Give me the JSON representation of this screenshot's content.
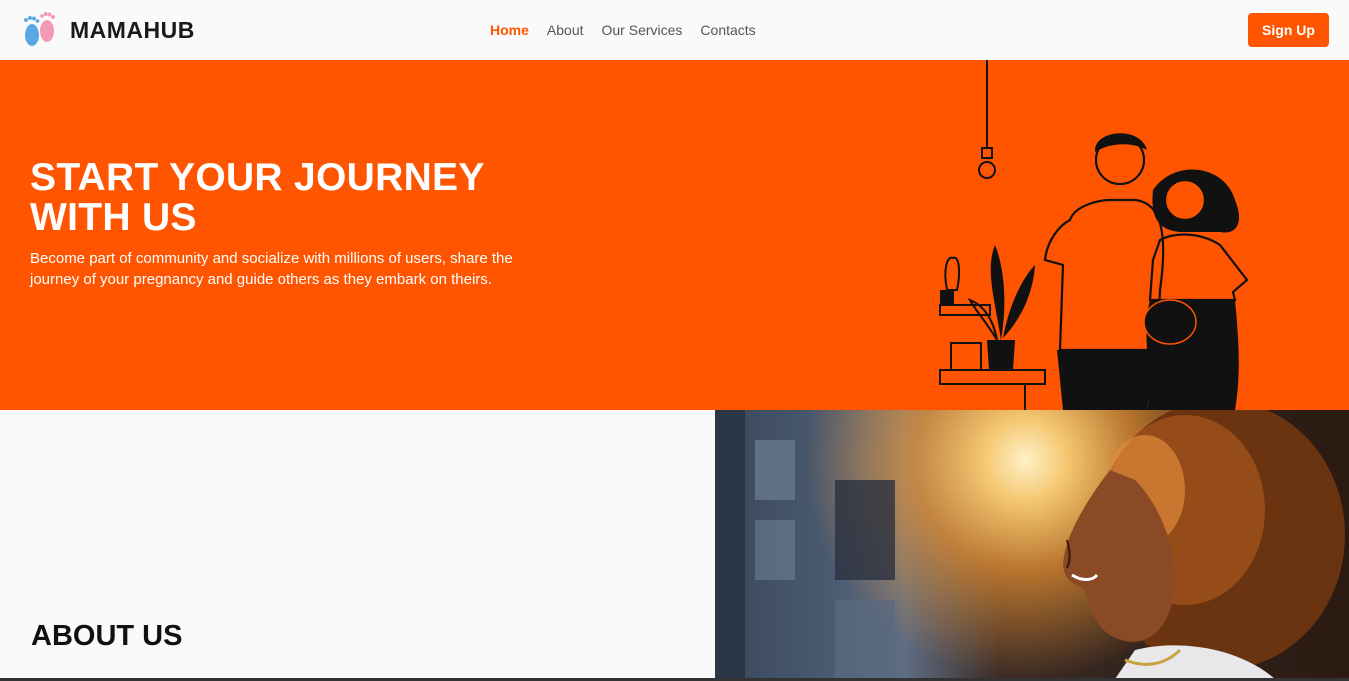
{
  "brand": {
    "name": "MAMAHUB",
    "icon": "baby-feet-icon"
  },
  "nav": {
    "items": [
      {
        "label": "Home",
        "active": true
      },
      {
        "label": "About",
        "active": false
      },
      {
        "label": "Our Services",
        "active": false
      },
      {
        "label": "Contacts",
        "active": false
      }
    ],
    "signup_label": "Sign Up"
  },
  "hero": {
    "title": "START YOUR JOURNEY WITH US",
    "text": "Become part of community and socialize with millions of users, share the journey of your pregnancy and guide others as they embark on theirs.",
    "illustration": "couple-expecting-illustration"
  },
  "about": {
    "title": "ABOUT US",
    "photo": "woman-sunset-portrait"
  },
  "colors": {
    "accent": "#ff5500",
    "background": "#fafafa",
    "text_dark": "#111111"
  }
}
